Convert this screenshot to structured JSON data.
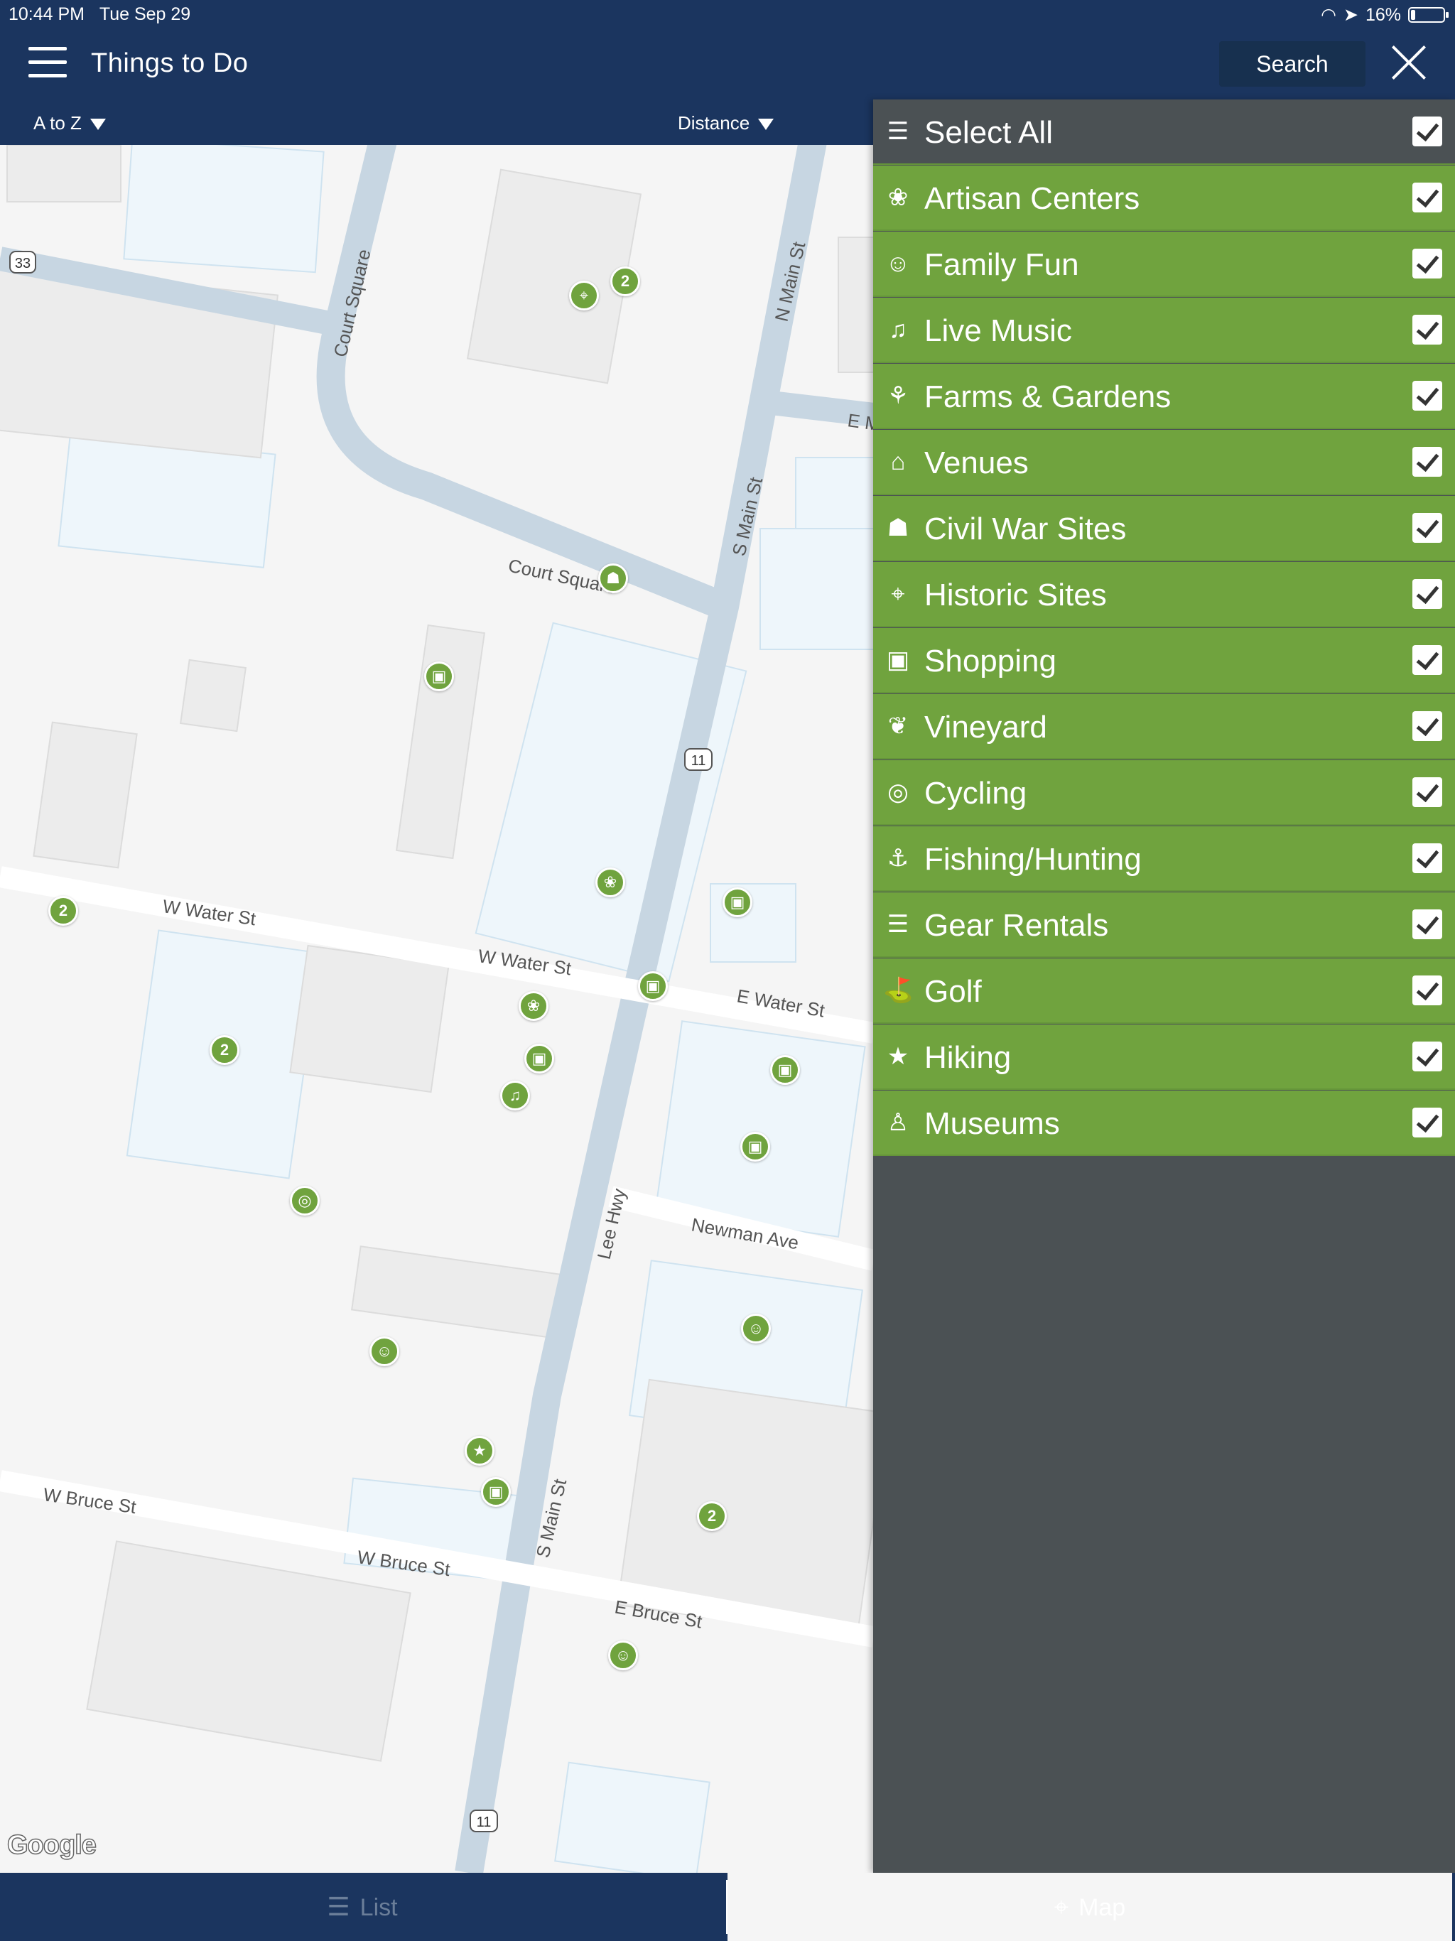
{
  "status_bar": {
    "time": "10:44 PM",
    "date": "Tue Sep 29",
    "battery": "16%"
  },
  "header": {
    "title": "Things to Do",
    "search_label": "Search"
  },
  "sort_bar": {
    "alpha_label": "A to Z",
    "distance_label": "Distance"
  },
  "filter_panel": {
    "select_all": {
      "label": "Select All",
      "checked": true
    },
    "items": [
      {
        "label": "Artisan Centers",
        "icon": "palette-icon",
        "checked": true
      },
      {
        "label": "Family Fun",
        "icon": "family-icon",
        "checked": true
      },
      {
        "label": "Live Music",
        "icon": "guitar-icon",
        "checked": true
      },
      {
        "label": "Farms & Gardens",
        "icon": "farmer-icon",
        "checked": true
      },
      {
        "label": "Venues",
        "icon": "building-icon",
        "checked": true
      },
      {
        "label": "Civil War Sites",
        "icon": "cannon-icon",
        "checked": true
      },
      {
        "label": "Historic Sites",
        "icon": "location-pin-icon",
        "checked": true
      },
      {
        "label": "Shopping",
        "icon": "shopping-bag-icon",
        "checked": true
      },
      {
        "label": "Vineyard",
        "icon": "wine-glasses-icon",
        "checked": true
      },
      {
        "label": "Cycling",
        "icon": "bicycle-icon",
        "checked": true
      },
      {
        "label": "Fishing/Hunting",
        "icon": "fishing-icon",
        "checked": true
      },
      {
        "label": "Gear Rentals",
        "icon": "kayak-icon",
        "checked": true
      },
      {
        "label": "Golf",
        "icon": "golfer-icon",
        "checked": true
      },
      {
        "label": "Hiking",
        "icon": "hiker-icon",
        "checked": true
      },
      {
        "label": "Museums",
        "icon": "bust-icon",
        "checked": true
      }
    ]
  },
  "map": {
    "streets": {
      "court_square_v": "Court Square",
      "court_square_h": "Court Square",
      "n_main": "N Main St",
      "s_main_top": "S Main St",
      "s_main_bottom": "S Main St",
      "lee_hwy": "Lee Hwy",
      "w_water_1": "W Water St",
      "w_water_2": "W Water St",
      "e_water": "E Water St",
      "newman": "Newman Ave",
      "w_bruce_1": "W Bruce St",
      "w_bruce_2": "W Bruce St",
      "e_bruce": "E Bruce St",
      "e_m": "E M",
      "shield_33": "33",
      "shield_11_a": "11",
      "shield_11_b": "11"
    },
    "cluster_count": "2",
    "attribution": "Google"
  },
  "tabs": {
    "list_label": "List",
    "map_label": "Map"
  },
  "colors": {
    "navy": "#1b355f",
    "green": "#70a33e",
    "panel_gray": "#4b5154"
  }
}
